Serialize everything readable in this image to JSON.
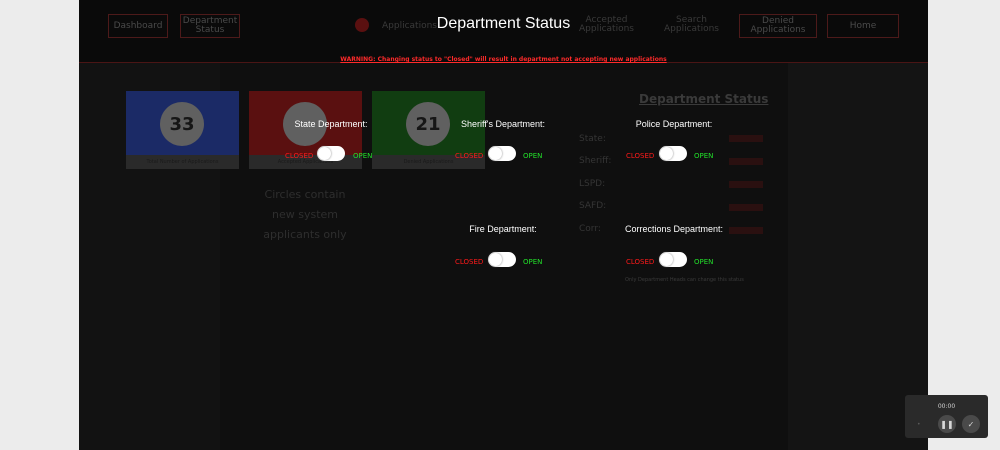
{
  "nav": {
    "dashboard": "Dashboard",
    "department_status_l1": "Department",
    "department_status_l2": "Status",
    "applications": "Applications",
    "accepted_l1": "Accepted",
    "accepted_l2": "Applications",
    "search_l1": "Search",
    "search_l2": "Applications",
    "denied_l1": "Denied",
    "denied_l2": "Applications",
    "home": "Home"
  },
  "modal": {
    "title": "Department Status",
    "warning": "WARNING: Changing status to \"Closed\" will result in department not accepting new applications",
    "note": "Only Department Heads can change this status",
    "closed_label": "CLOSED",
    "open_label": "OPEN"
  },
  "departments": [
    {
      "label": "State Department:"
    },
    {
      "label": "Sheriff's Department:"
    },
    {
      "label": "Police Department:"
    },
    {
      "label": "Fire Department:"
    },
    {
      "label": "Corrections Department:"
    }
  ],
  "stats": [
    {
      "value": "33",
      "label": "Total Number of Applications",
      "color": "#1b2a66"
    },
    {
      "value": "",
      "label": "Accepted Applications",
      "color": "#5a1010"
    },
    {
      "value": "21",
      "label": "Denied Applications",
      "color": "#113d11"
    }
  ],
  "circles_note": "Circles contain new system applicants only",
  "status_panel": {
    "title": "Department Status",
    "rows": [
      "State:",
      "Sheriff:",
      "LSPD:",
      "SAFD:",
      "Corr:"
    ]
  },
  "recorder": {
    "time": "00:00",
    "pause_icon": "pause-icon",
    "check_icon": "check-icon"
  }
}
